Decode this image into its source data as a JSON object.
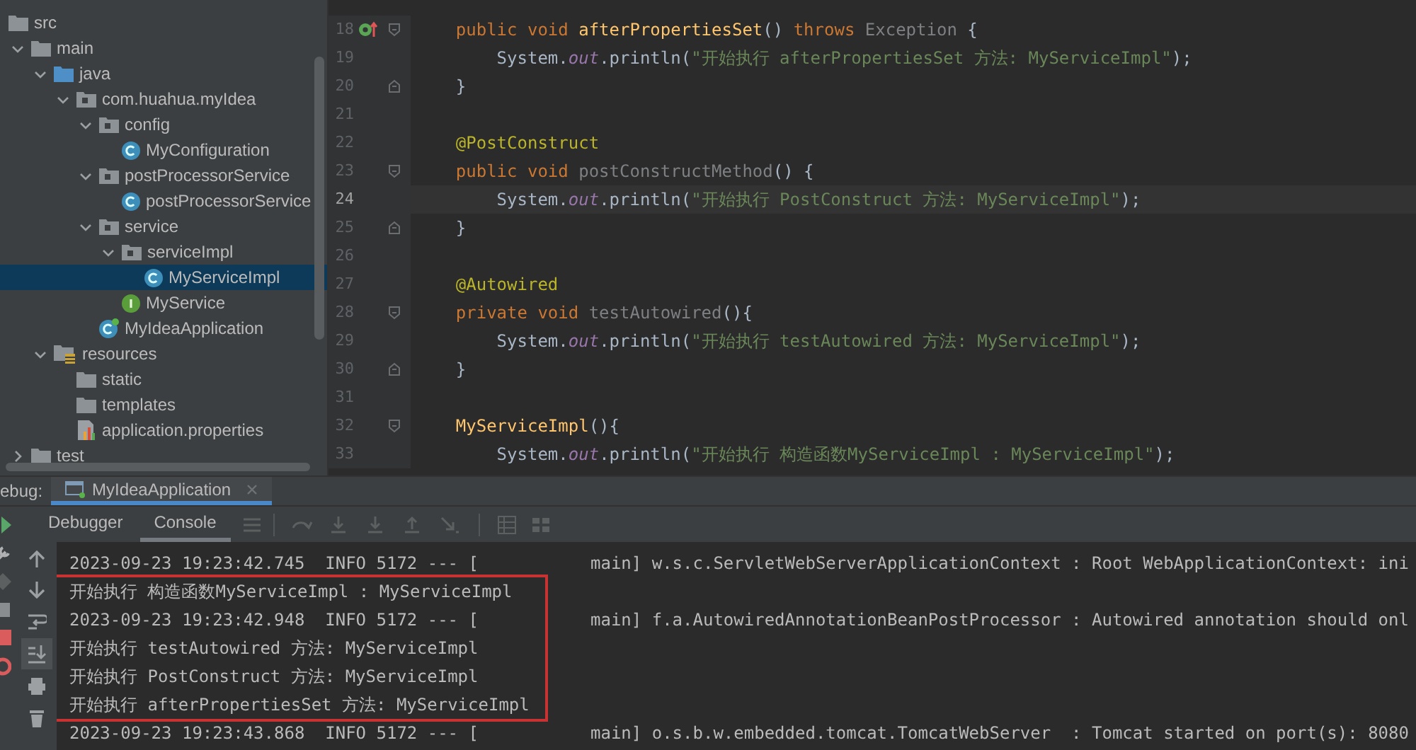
{
  "project_tree": [
    {
      "label": "src",
      "kind": "folder",
      "selected": false,
      "children": [
        {
          "label": "main",
          "kind": "folder",
          "selected": false,
          "expanded": true,
          "children": [
            {
              "label": "java",
              "kind": "source-folder",
              "selected": false,
              "expanded": true,
              "children": [
                {
                  "label": "com.huahua.myIdea",
                  "kind": "package",
                  "selected": false,
                  "expanded": true,
                  "children": [
                    {
                      "label": "config",
                      "kind": "package",
                      "selected": false,
                      "expanded": true,
                      "children": [
                        {
                          "label": "MyConfiguration",
                          "kind": "class",
                          "selected": false
                        }
                      ]
                    },
                    {
                      "label": "postProcessorService",
                      "kind": "package",
                      "selected": false,
                      "expanded": true,
                      "children": [
                        {
                          "label": "postProcessorService",
                          "kind": "class",
                          "selected": false
                        }
                      ]
                    },
                    {
                      "label": "service",
                      "kind": "package",
                      "selected": false,
                      "expanded": true,
                      "children": [
                        {
                          "label": "serviceImpl",
                          "kind": "package",
                          "selected": false,
                          "expanded": true,
                          "children": [
                            {
                              "label": "MyServiceImpl",
                              "kind": "class",
                              "selected": true
                            }
                          ]
                        },
                        {
                          "label": "MyService",
                          "kind": "interface",
                          "selected": false
                        }
                      ]
                    },
                    {
                      "label": "MyIdeaApplication",
                      "kind": "app-class",
                      "selected": false
                    }
                  ]
                }
              ]
            },
            {
              "label": "resources",
              "kind": "resource-folder",
              "selected": false,
              "expanded": true,
              "children": [
                {
                  "label": "static",
                  "kind": "folder",
                  "selected": false
                },
                {
                  "label": "templates",
                  "kind": "folder",
                  "selected": false
                },
                {
                  "label": "application.properties",
                  "kind": "properties",
                  "selected": false
                }
              ]
            }
          ]
        },
        {
          "label": "test",
          "kind": "folder",
          "selected": false,
          "expanded": false
        }
      ]
    }
  ],
  "editor": {
    "lines": [
      {
        "number": "18",
        "current": false,
        "gutter_icon": {
          "kind": "implements"
        },
        "fold_marker": {
          "kind": "start"
        },
        "tokens": [
          {
            "kind": "keyword",
            "t": "    public void "
          },
          {
            "kind": "method",
            "t": "afterPropertiesSet"
          },
          {
            "kind": "plain",
            "t": "() "
          },
          {
            "kind": "keyword",
            "t": "throws "
          },
          {
            "kind": "unused",
            "t": "Exception"
          },
          {
            "kind": "plain",
            "t": " {"
          }
        ]
      },
      {
        "number": "19",
        "current": false,
        "tokens": [
          {
            "kind": "plain",
            "t": "        System."
          },
          {
            "kind": "static",
            "t": "out"
          },
          {
            "kind": "plain",
            "t": ".println("
          },
          {
            "kind": "string",
            "t": "\"开始执行 afterPropertiesSet 方法: MyServiceImpl\""
          },
          {
            "kind": "plain",
            "t": ");"
          }
        ]
      },
      {
        "number": "20",
        "current": false,
        "fold_marker": {
          "kind": "end"
        },
        "tokens": [
          {
            "kind": "plain",
            "t": "    }"
          }
        ]
      },
      {
        "number": "21",
        "current": false
      },
      {
        "number": "22",
        "current": false,
        "tokens": [
          {
            "kind": "annotation",
            "t": "    @PostConstruct"
          }
        ]
      },
      {
        "number": "23",
        "current": false,
        "fold_marker": {
          "kind": "start"
        },
        "tokens": [
          {
            "kind": "keyword",
            "t": "    public void "
          },
          {
            "kind": "unused",
            "t": "postConstructMethod"
          },
          {
            "kind": "plain",
            "t": "() {"
          }
        ]
      },
      {
        "number": "24",
        "current": true,
        "tokens": [
          {
            "kind": "plain",
            "t": "        System."
          },
          {
            "kind": "static",
            "t": "out"
          },
          {
            "kind": "plain",
            "t": ".println("
          },
          {
            "kind": "string",
            "t": "\"开始执行 PostConstruct 方法: MyServiceImpl\""
          },
          {
            "kind": "plain",
            "t": ");"
          }
        ]
      },
      {
        "number": "25",
        "current": false,
        "fold_marker": {
          "kind": "end"
        },
        "tokens": [
          {
            "kind": "plain",
            "t": "    }"
          }
        ]
      },
      {
        "number": "26",
        "current": false
      },
      {
        "number": "27",
        "current": false,
        "tokens": [
          {
            "kind": "annotation",
            "t": "    @Autowired"
          }
        ]
      },
      {
        "number": "28",
        "current": false,
        "fold_marker": {
          "kind": "start"
        },
        "tokens": [
          {
            "kind": "keyword",
            "t": "    private void "
          },
          {
            "kind": "unused",
            "t": "testAutowired"
          },
          {
            "kind": "plain",
            "t": "(){"
          }
        ]
      },
      {
        "number": "29",
        "current": false,
        "tokens": [
          {
            "kind": "plain",
            "t": "        System."
          },
          {
            "kind": "static",
            "t": "out"
          },
          {
            "kind": "plain",
            "t": ".println("
          },
          {
            "kind": "string",
            "t": "\"开始执行 testAutowired 方法: MyServiceImpl\""
          },
          {
            "kind": "plain",
            "t": ");"
          }
        ]
      },
      {
        "number": "30",
        "current": false,
        "fold_marker": {
          "kind": "end"
        },
        "tokens": [
          {
            "kind": "plain",
            "t": "    }"
          }
        ]
      },
      {
        "number": "31",
        "current": false
      },
      {
        "number": "32",
        "current": false,
        "fold_marker": {
          "kind": "start"
        },
        "tokens": [
          {
            "kind": "method",
            "t": "    MyServiceImpl"
          },
          {
            "kind": "plain",
            "t": "(){"
          }
        ]
      },
      {
        "number": "33",
        "current": false,
        "tokens": [
          {
            "kind": "plain",
            "t": "        System."
          },
          {
            "kind": "static",
            "t": "out"
          },
          {
            "kind": "plain",
            "t": ".println("
          },
          {
            "kind": "string",
            "t": "\"开始执行 构造函数MyServiceImpl : MyServiceImpl\""
          },
          {
            "kind": "plain",
            "t": ");"
          }
        ]
      }
    ]
  },
  "debug": {
    "label": "ebug:",
    "tabs": [
      {
        "label": "MyIdeaApplication",
        "selected": true
      }
    ],
    "subtabs": [
      {
        "label": "Debugger",
        "selected": false
      },
      {
        "label": "Console",
        "selected": true
      }
    ],
    "soft_wrap_on": false,
    "scroll_to_end_on": true,
    "console": {
      "lines_before": [
        {
          "text": "2023-09-23 19:23:42.745  INFO 5172 --- [",
          "detail": "main] w.s.c.ServletWebServerApplicationContext : Root WebApplicationContext: ini"
        }
      ],
      "highlighted_lines": [
        {
          "text": "开始执行 构造函数MyServiceImpl : MyServiceImpl"
        },
        {
          "text": "2023-09-23 19:23:42.948  INFO 5172 --- [",
          "detail": "main] f.a.AutowiredAnnotationBeanPostProcessor : Autowired annotation should onl"
        },
        {
          "text": "开始执行 testAutowired 方法: MyServiceImpl"
        },
        {
          "text": "开始执行 PostConstruct 方法: MyServiceImpl"
        },
        {
          "text": "开始执行 afterPropertiesSet 方法: MyServiceImpl"
        }
      ],
      "lines_after": [
        {
          "text": "2023-09-23 19:23:43.868  INFO 5172 --- [",
          "detail": "main] o.s.b.w.embedded.tomcat.TomcatWebServer  : Tomcat started on port(s): 8080"
        }
      ]
    }
  }
}
